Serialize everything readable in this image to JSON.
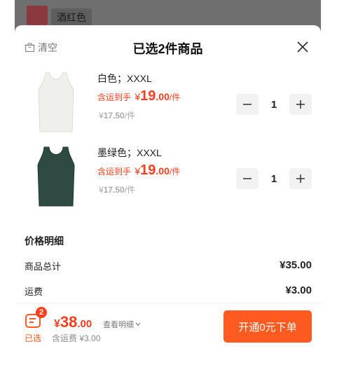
{
  "background": {
    "variant_chip": "酒红色",
    "colors": {
      "overlay": "#7c7c7c",
      "thumb": "#8a3a3f"
    }
  },
  "header": {
    "clear_icon": "trash-icon",
    "clear_label": "清空",
    "title": "已选2件商品",
    "close_icon": "close-icon"
  },
  "items": [
    {
      "spec": "白色；XXXL",
      "price_prefix": "含运到手",
      "price_yen": "¥",
      "price_int": "19",
      "price_dec": ".00",
      "price_unit": "/件",
      "old_yen": "¥",
      "old_price": "17.50",
      "old_unit": "/件",
      "quantity": "1",
      "image_color": "#efefec"
    },
    {
      "spec": "墨绿色；XXXL",
      "price_prefix": "含运到手",
      "price_yen": "¥",
      "price_int": "19",
      "price_dec": ".00",
      "price_unit": "/件",
      "old_yen": "¥",
      "old_price": "17.50",
      "old_unit": "/件",
      "quantity": "1",
      "image_color": "#2e4a42"
    }
  ],
  "price_detail": {
    "title": "价格明细",
    "rows": [
      {
        "label": "商品总计",
        "value": "¥35.00"
      },
      {
        "label": "运费",
        "value": "¥3.00"
      }
    ]
  },
  "footer": {
    "cart_icon": "cart-icon",
    "badge": "2",
    "selected_label": "已选",
    "total_yen": "¥",
    "total_int": "38",
    "total_dec": ".00",
    "view_detail": "查看明细",
    "shipping_note": "含运费 ¥3.00",
    "cta_label": "开通0元下单"
  },
  "colors": {
    "accent": "#ff5a1f",
    "price": "#ff3d1f",
    "muted": "#aaaaaa"
  }
}
